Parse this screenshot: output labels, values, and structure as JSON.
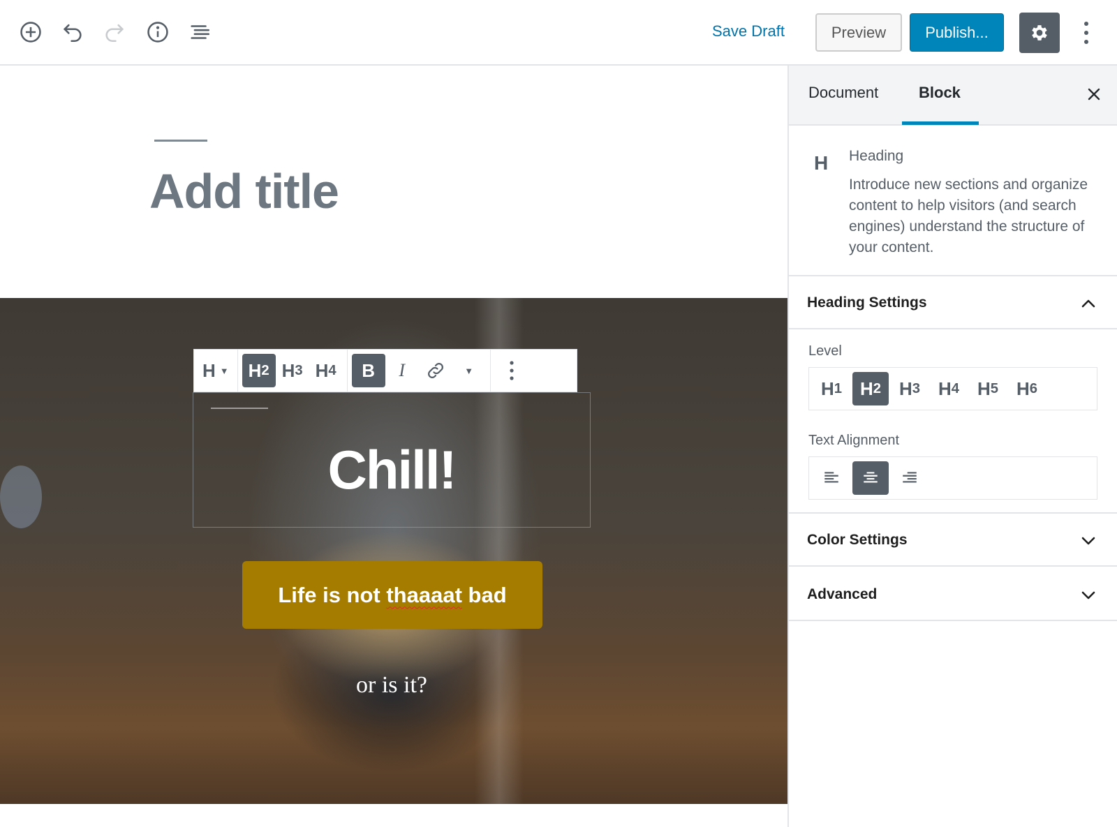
{
  "toolbar": {
    "add_block_icon": "plus-circle-icon",
    "undo_icon": "undo-icon",
    "redo_icon": "redo-icon",
    "info_icon": "info-icon",
    "outline_icon": "list-icon",
    "save_draft": "Save Draft",
    "preview": "Preview",
    "publish": "Publish...",
    "settings_icon": "gear-icon",
    "more_icon": "vertical-ellipsis-icon"
  },
  "editor": {
    "title_placeholder": "Add title",
    "cover": {
      "heading": "Chill!",
      "button_text_prefix": "Life is not ",
      "button_text_misspelled": "thaaaat",
      "button_text_suffix": " bad",
      "subtext": "or is it?",
      "button_color": "#a67c00"
    },
    "block_toolbar": {
      "block_type": "H",
      "levels": [
        {
          "base": "H",
          "num": "2",
          "active": true
        },
        {
          "base": "H",
          "num": "3",
          "active": false
        },
        {
          "base": "H",
          "num": "4",
          "active": false
        }
      ],
      "bold": "B",
      "italic": "I",
      "link_icon": "link-icon",
      "more_formats_icon": "chevron-down-icon",
      "block_more_icon": "vertical-ellipsis-icon"
    }
  },
  "sidebar": {
    "tabs": [
      {
        "label": "Document",
        "active": false
      },
      {
        "label": "Block",
        "active": true
      }
    ],
    "close_icon": "close-icon",
    "block_info": {
      "icon": "H",
      "title": "Heading",
      "description": "Introduce new sections and organize content to help visitors (and search engines) understand the structure of your content."
    },
    "heading_settings": {
      "title": "Heading Settings",
      "expanded": true,
      "level_label": "Level",
      "levels": [
        {
          "base": "H",
          "num": "1",
          "active": false
        },
        {
          "base": "H",
          "num": "2",
          "active": true
        },
        {
          "base": "H",
          "num": "3",
          "active": false
        },
        {
          "base": "H",
          "num": "4",
          "active": false
        },
        {
          "base": "H",
          "num": "5",
          "active": false
        },
        {
          "base": "H",
          "num": "6",
          "active": false
        }
      ],
      "alignment_label": "Text Alignment",
      "alignments": [
        {
          "name": "align-left-icon",
          "active": false
        },
        {
          "name": "align-center-icon",
          "active": true
        },
        {
          "name": "align-right-icon",
          "active": false
        }
      ]
    },
    "color_settings": {
      "title": "Color Settings",
      "expanded": false
    },
    "advanced": {
      "title": "Advanced",
      "expanded": false
    }
  },
  "colors": {
    "accent": "#0085ba",
    "link": "#0073aa",
    "dark_button": "#555d66"
  }
}
